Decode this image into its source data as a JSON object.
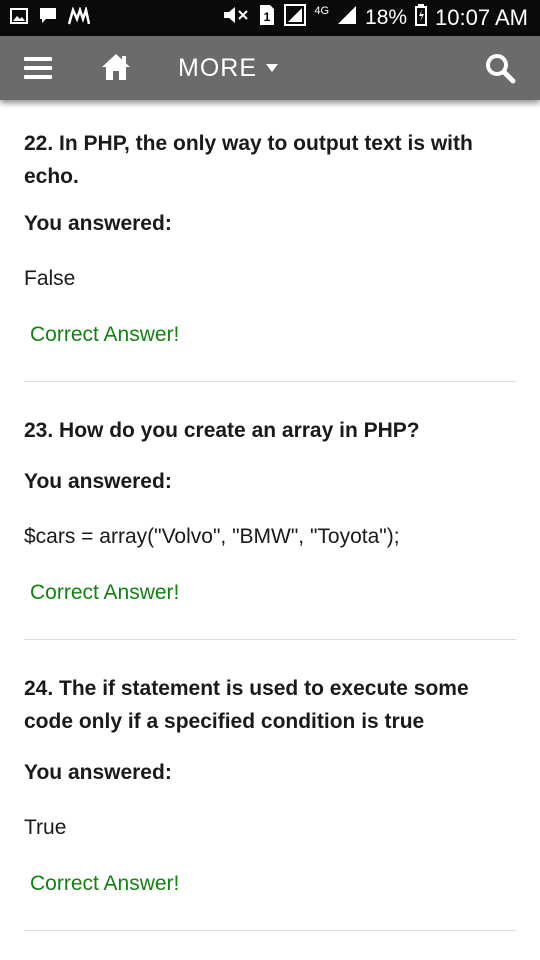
{
  "status_bar": {
    "battery": "18%",
    "time": "10:07 AM",
    "network": "4G",
    "icons": [
      "gallery-icon",
      "chat-icon",
      "app-icon",
      "mute-icon",
      "sim-icon",
      "signal-icon",
      "battery-icon"
    ]
  },
  "toolbar": {
    "more_label": "MORE",
    "icons": [
      "menu-icon",
      "home-icon",
      "caret-down-icon",
      "search-icon"
    ]
  },
  "questions": [
    {
      "title": "22. In PHP, the only way to output text is with echo.",
      "answered_label": "You answered:",
      "answer": "False",
      "result": "Correct Answer!"
    },
    {
      "title": "23. How do you create an array in PHP?",
      "answered_label": "You answered:",
      "answer": "$cars = array(\"Volvo\", \"BMW\", \"Toyota\");",
      "result": "Correct Answer!"
    },
    {
      "title": "24. The if statement is used to execute some code only if a specified condition is true",
      "answered_label": "You answered:",
      "answer": "True",
      "result": "Correct Answer!"
    }
  ],
  "colors": {
    "toolbar": "#6b6b6b",
    "status_bar": "#0a0a0a",
    "correct": "#128212",
    "divider": "#dedede"
  }
}
